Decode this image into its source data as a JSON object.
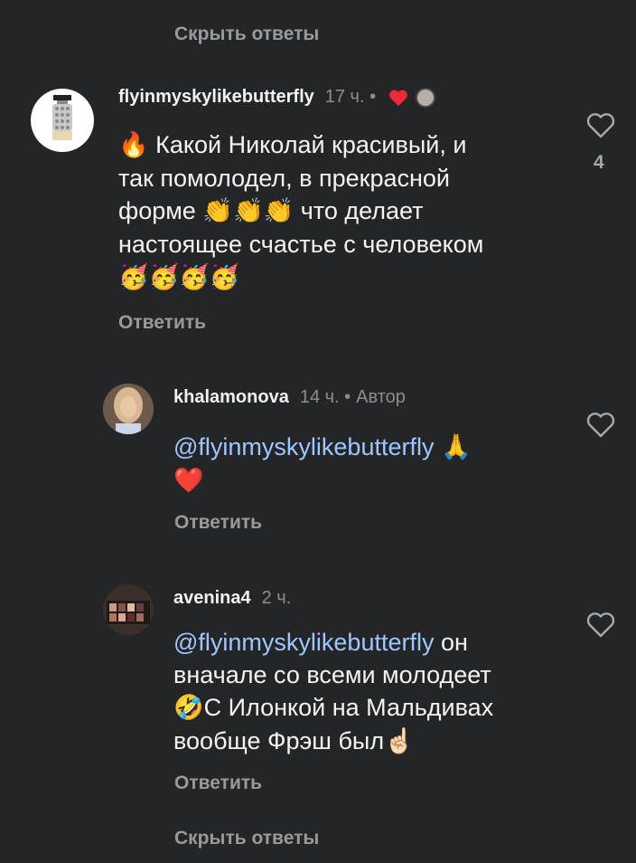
{
  "hide_replies_top": "Скрыть ответы",
  "hide_replies_bottom": "Скрыть ответы",
  "comment_main": {
    "username": "flyinmyskylikebutterfly",
    "time": "17 ч. •",
    "text_line1_emoji": "🔥",
    "text_line1": "Какой Николай красивый, и",
    "text_line2": "так помолодел, в прекрасной",
    "text_line3a": "форме",
    "text_line3_emoji": "👏👏👏",
    "text_line3b": "что делает",
    "text_line4": "настоящее счастье с человеком",
    "text_line5_emoji": "🥳🥳🥳🥳",
    "reply_label": "Ответить",
    "like_count": "4"
  },
  "reply1": {
    "username": "khalamonova",
    "time": "14 ч. •",
    "author_badge": "Автор",
    "mention": "@flyinmyskylikebutterfly",
    "emoji_line1": "🙏",
    "emoji_line2": "❤️",
    "reply_label": "Ответить"
  },
  "reply2": {
    "username": "avenina4",
    "time": "2 ч.",
    "mention": "@flyinmyskylikebutterfly",
    "text_line1": "он",
    "text_line2": "вначале со всеми молодеет",
    "text_line3_emoji": "🤣",
    "text_line3": "С Илонкой на Мальдивах",
    "text_line4": "вообще Фрэш был",
    "text_line4_emoji": "☝🏻",
    "reply_label": "Ответить"
  },
  "colors": {
    "background": "#242527",
    "liked_heart": "#ed2a3a",
    "mention": "#9fc7ff"
  },
  "icons": [
    "heart-outline-icon",
    "heart-filled-icon",
    "fire-emoji",
    "clap-emoji",
    "party-face-emoji",
    "pray-emoji",
    "rofl-emoji",
    "point-up-emoji"
  ]
}
